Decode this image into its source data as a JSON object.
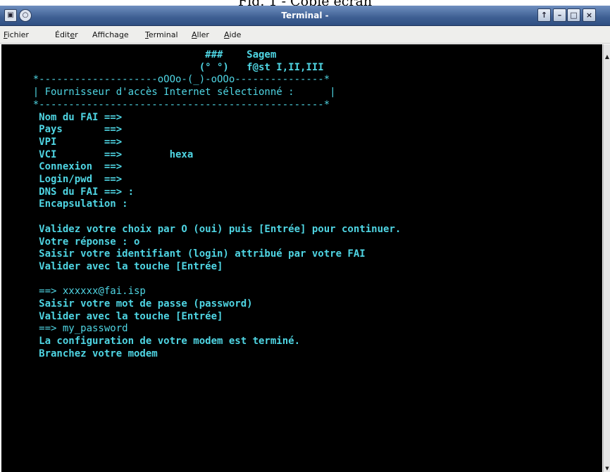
{
  "caption": "Fig. 1 - Copie écran",
  "window": {
    "title": "Terminal -",
    "buttons": {
      "up": "↑",
      "minimize": "–",
      "maximize": "□",
      "close": "×"
    }
  },
  "menubar": {
    "items": [
      {
        "pre": "",
        "mnemonic": "F",
        "post": "ichier"
      },
      {
        "pre": "Édit",
        "mnemonic": "e",
        "post": "r"
      },
      {
        "pre": "Afficha",
        "mnemonic": "g",
        "post": "e"
      },
      {
        "pre": "",
        "mnemonic": "T",
        "post": "erminal"
      },
      {
        "pre": "",
        "mnemonic": "A",
        "post": "ller"
      },
      {
        "pre": "",
        "mnemonic": "A",
        "post": "ide"
      }
    ]
  },
  "terminal": {
    "lines": [
      "                                 ###    Sagem",
      "                                (° °)   f@st I,II,III",
      "    *--------------------oOOo-(_)-oOOo---------------*",
      "    | Fournisseur d'accès Internet sélectionné :      |",
      "    *------------------------------------------------*",
      "     Nom du FAI ==>",
      "     Pays       ==>",
      "     VPI        ==>",
      "     VCI        ==>        hexa",
      "     Connexion  ==>",
      "     Login/pwd  ==>",
      "     DNS du FAI ==> :",
      "     Encapsulation :",
      "",
      "     Validez votre choix par O (oui) puis [Entrée] pour continuer.",
      "     Votre réponse : o",
      "     Saisir votre identifiant (login) attribué par votre FAI",
      "     Valider avec la touche [Entrée]",
      "",
      "     ==> xxxxxx@fai.isp",
      "     Saisir votre mot de passe (password)",
      "     Valider avec la touche [Entrée]",
      "     ==> my_password",
      "     La configuration de votre modem est terminé.",
      "     Branchez votre modem"
    ],
    "bold": [
      true,
      true,
      false,
      false,
      false,
      true,
      true,
      true,
      true,
      true,
      true,
      true,
      true,
      false,
      true,
      true,
      true,
      true,
      false,
      false,
      true,
      true,
      false,
      true,
      true
    ]
  }
}
